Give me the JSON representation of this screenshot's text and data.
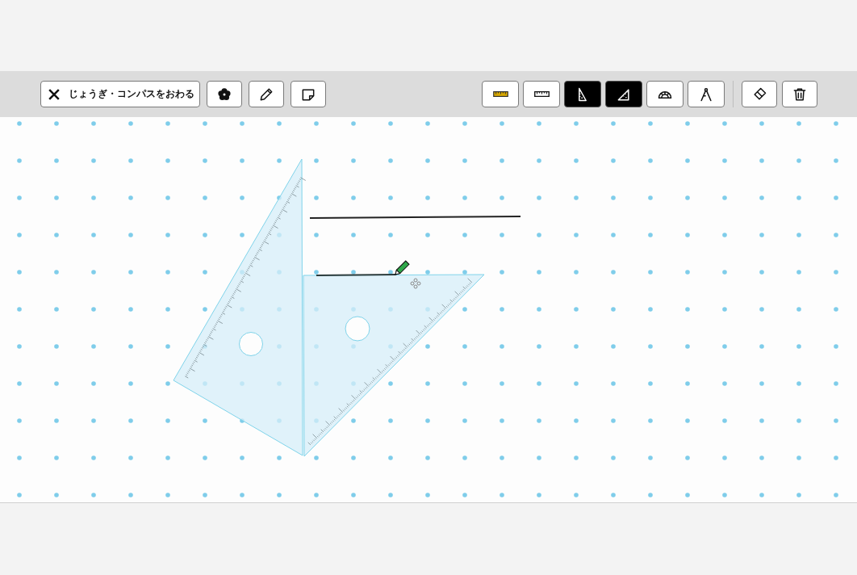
{
  "toolbar": {
    "left": [
      {
        "kind": "close",
        "label": "じょうぎ・コンパスをおわる"
      },
      {
        "kind": "stamp"
      },
      {
        "kind": "pencil"
      },
      {
        "kind": "note"
      }
    ],
    "tools": [
      {
        "kind": "ruler-color",
        "selected": false
      },
      {
        "kind": "ruler",
        "selected": false
      },
      {
        "kind": "set-square-30",
        "selected": true
      },
      {
        "kind": "set-square-45",
        "selected": true
      },
      {
        "kind": "protractor",
        "selected": false
      },
      {
        "kind": "compass",
        "selected": false
      }
    ],
    "actions": [
      {
        "kind": "eraser"
      },
      {
        "kind": "trash"
      }
    ]
  }
}
